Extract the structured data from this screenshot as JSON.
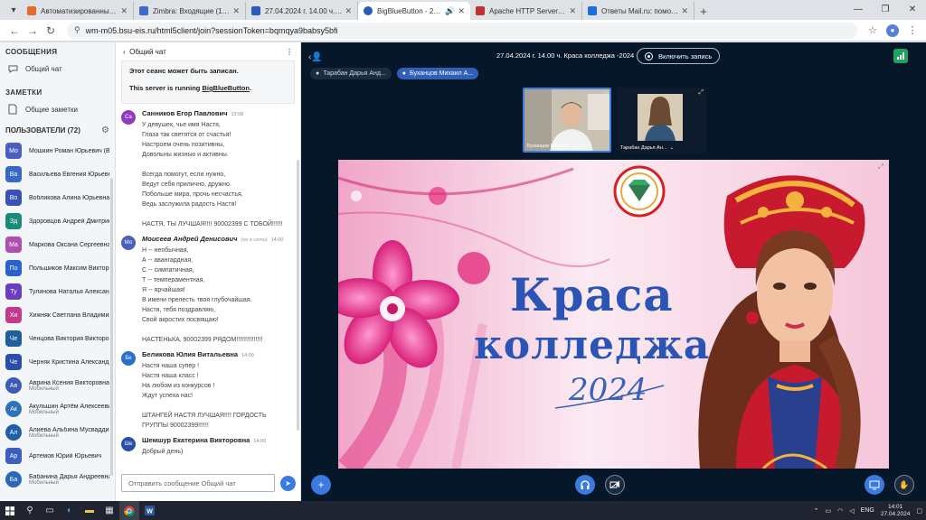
{
  "browser": {
    "tabs": [
      {
        "title": "Автоматизированные систе",
        "color": "#e06c2b"
      },
      {
        "title": "Zimbra: Входящие (1939)",
        "color": "#3a6cc7"
      },
      {
        "title": "27.04.2024 г. 14.00 ч. Краса к",
        "color": "#2a5bb8"
      },
      {
        "title": "BigBlueButton - 27.04.2024",
        "color": "#2a5bb8"
      },
      {
        "title": "Apache HTTP Server Test Page",
        "color": "#c0312d"
      },
      {
        "title": "Ответы Mail.ru: помогите пл",
        "color": "#1c6fde"
      }
    ],
    "url": "wm-m05.bsu-eis.ru/html5client/join?sessionToken=bqmqya9babsy5bfi"
  },
  "sidebar": {
    "messages_title": "СООБЩЕНИЯ",
    "public_chat": "Общий чат",
    "notes_title": "ЗАМЕТКИ",
    "shared_notes": "Общие заметки",
    "users_title": "ПОЛЬЗОВАТЕЛИ (72)"
  },
  "users": [
    {
      "abbr": "Мо",
      "name": "Мошкин Роман Юрьевич (Вы)",
      "color": "#4b5fbf",
      "dot": "blue",
      "sub": ""
    },
    {
      "abbr": "Ва",
      "name": "Васильева Евгения Юрьевна",
      "color": "#3768c4",
      "dot": "red",
      "sub": ""
    },
    {
      "abbr": "Во",
      "name": "Вобликова Алина Юрьевна",
      "color": "#3b52b5",
      "dot": "red",
      "sub": ""
    },
    {
      "abbr": "Зд",
      "name": "Здоровцов Андрей Дмитриевич",
      "color": "#1a8a7a",
      "dot": "red",
      "sub": ""
    },
    {
      "abbr": "Ма",
      "name": "Маркова Оксана Сергеевна",
      "color": "#b04fb0",
      "dot": "red",
      "sub": ""
    },
    {
      "abbr": "По",
      "name": "Польшиков Максим Викторович",
      "color": "#2a62c9",
      "dot": "red",
      "sub": ""
    },
    {
      "abbr": "Ту",
      "name": "Тулинова Наталья Александро...",
      "color": "#6a3fbf",
      "dot": "red",
      "sub": ""
    },
    {
      "abbr": "Хи",
      "name": "Хижняк Светлана Владимиров...",
      "color": "#c23a8a",
      "dot": "red",
      "sub": ""
    },
    {
      "abbr": "Че",
      "name": "Ченцова Виктория Викторовна",
      "color": "#1f5f9c",
      "dot": "none",
      "sub": ""
    },
    {
      "abbr": "Че",
      "name": "Черняк Кристина Александров...",
      "color": "#2b4fa8",
      "dot": "red",
      "sub": ""
    },
    {
      "abbr": "Ав",
      "name": "Аврина Ксения Викторовна",
      "color": "#3c5bb5",
      "dot": "blue",
      "sub": "Мобильный"
    },
    {
      "abbr": "Ак",
      "name": "Акульшин Артём Алексеевич",
      "color": "#2e73b8",
      "dot": "blue",
      "sub": "Мобильный"
    },
    {
      "abbr": "Ал",
      "name": "Алиева Альбина Мусваддинов...",
      "color": "#1e5fa8",
      "dot": "blue",
      "sub": "Мобильный"
    },
    {
      "abbr": "Ар",
      "name": "Артемов Юрий Юрьевич",
      "color": "#3a5fbd",
      "dot": "blue",
      "sub": ""
    },
    {
      "abbr": "Ба",
      "name": "Бабанина Дарья Андреевна",
      "color": "#2c68b8",
      "dot": "blue",
      "sub": "Мобильный"
    }
  ],
  "chat": {
    "back_label": "Общий чат",
    "notice_line1": "Этот сеанс может быть записан.",
    "notice_line2_prefix": "This server is running ",
    "notice_link": "BigBlueButton",
    "notice_line2_suffix": ".",
    "input_placeholder": "Отправить сообщение Общий чат",
    "messages": [
      {
        "abbr": "Са",
        "color": "#8e3bbf",
        "name": "Санников Егор Павлович",
        "status": "",
        "time": "13:58",
        "lines": [
          "У девушек, чье имя Настя,",
          "Глаза так светятся от счастья!",
          "Настроем очень позитивны,",
          "Довольны жизнью и активны.",
          "",
          "Всегда помогут, если нужно,",
          "Ведут себя прилично, дружно.",
          "Побольше мира, прочь несчастья,",
          "Ведь заслужила радость Настя!",
          "",
          "НАСТЯ, ТЫ ЛУЧШАЯ!!!! 90002399 С ТОБОЙ!!!!!!"
        ]
      },
      {
        "abbr": "Мо",
        "color": "#4b5fbf",
        "name": "Моисеев Андрей Денисович",
        "status": "(не в сети)",
        "time": "14:00",
        "lines": [
          "Н -- необычная,",
          "А -- авангардная,",
          "С -- симпатичная,",
          "Т -- темпераментная,",
          "Я -- ярчайшая!",
          "В имени прелесть твоя глубочайшая.",
          "Настя, тебя поздравляю,",
          "Свой акростих посвящаю!",
          "",
          "НАСТЕНЬКА, 90002399 РЯДОМ!!!!!!!!!!!!!!!"
        ]
      },
      {
        "abbr": "Бе",
        "color": "#2a6fd0",
        "name": "Беликова Юлия Витальевна",
        "status": "",
        "time": "14:00",
        "lines": [
          "Настя наша супер !",
          "Настя наша класс !",
          "На любом из конкурсов !",
          "Ждут успеха нас!",
          "",
          "ШТАНГЕЙ НАСТЯ ЛУЧШАЯ!!!! ГОРДОСТЬ",
          "ГРУППЫ 90002399!!!!!!"
        ]
      },
      {
        "abbr": "Ше",
        "color": "#2b4fa8",
        "name": "Шемшур Екатерина Викторовна",
        "status": "",
        "time": "14:00",
        "lines": [
          "Добрый день)"
        ]
      }
    ]
  },
  "stage": {
    "title": "27.04.2024 г. 14.00 ч. Краса колледжа -2024",
    "record_label": "Включить запись",
    "talkers": [
      "Тарабан Дарья Анд...",
      "Буханцов Михаил А..."
    ],
    "cams": [
      "Буханцов Михаил...",
      "Тарабан Дарья Ан..."
    ],
    "slide_title_1": "Краса",
    "slide_title_2": "колледжа",
    "slide_year": "2024"
  },
  "taskbar": {
    "lang": "ENG",
    "time": "14:01",
    "date": "27.04.2024"
  }
}
